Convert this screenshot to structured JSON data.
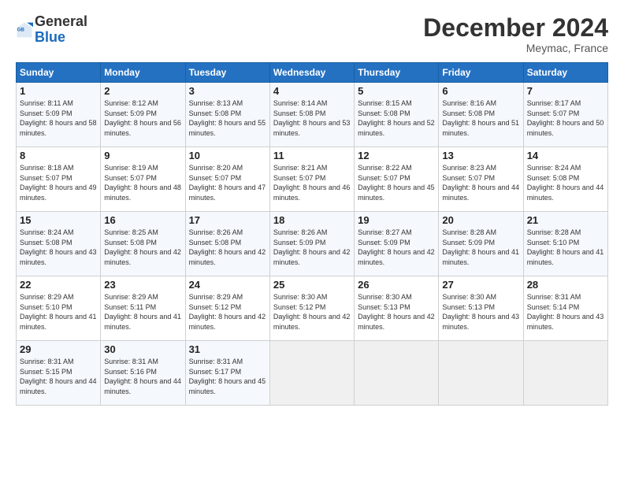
{
  "logo": {
    "general": "General",
    "blue": "Blue"
  },
  "title": "December 2024",
  "location": "Meymac, France",
  "header_days": [
    "Sunday",
    "Monday",
    "Tuesday",
    "Wednesday",
    "Thursday",
    "Friday",
    "Saturday"
  ],
  "weeks": [
    [
      {
        "day": "1",
        "sunrise": "Sunrise: 8:11 AM",
        "sunset": "Sunset: 5:09 PM",
        "daylight": "Daylight: 8 hours and 58 minutes."
      },
      {
        "day": "2",
        "sunrise": "Sunrise: 8:12 AM",
        "sunset": "Sunset: 5:09 PM",
        "daylight": "Daylight: 8 hours and 56 minutes."
      },
      {
        "day": "3",
        "sunrise": "Sunrise: 8:13 AM",
        "sunset": "Sunset: 5:08 PM",
        "daylight": "Daylight: 8 hours and 55 minutes."
      },
      {
        "day": "4",
        "sunrise": "Sunrise: 8:14 AM",
        "sunset": "Sunset: 5:08 PM",
        "daylight": "Daylight: 8 hours and 53 minutes."
      },
      {
        "day": "5",
        "sunrise": "Sunrise: 8:15 AM",
        "sunset": "Sunset: 5:08 PM",
        "daylight": "Daylight: 8 hours and 52 minutes."
      },
      {
        "day": "6",
        "sunrise": "Sunrise: 8:16 AM",
        "sunset": "Sunset: 5:08 PM",
        "daylight": "Daylight: 8 hours and 51 minutes."
      },
      {
        "day": "7",
        "sunrise": "Sunrise: 8:17 AM",
        "sunset": "Sunset: 5:07 PM",
        "daylight": "Daylight: 8 hours and 50 minutes."
      }
    ],
    [
      {
        "day": "8",
        "sunrise": "Sunrise: 8:18 AM",
        "sunset": "Sunset: 5:07 PM",
        "daylight": "Daylight: 8 hours and 49 minutes."
      },
      {
        "day": "9",
        "sunrise": "Sunrise: 8:19 AM",
        "sunset": "Sunset: 5:07 PM",
        "daylight": "Daylight: 8 hours and 48 minutes."
      },
      {
        "day": "10",
        "sunrise": "Sunrise: 8:20 AM",
        "sunset": "Sunset: 5:07 PM",
        "daylight": "Daylight: 8 hours and 47 minutes."
      },
      {
        "day": "11",
        "sunrise": "Sunrise: 8:21 AM",
        "sunset": "Sunset: 5:07 PM",
        "daylight": "Daylight: 8 hours and 46 minutes."
      },
      {
        "day": "12",
        "sunrise": "Sunrise: 8:22 AM",
        "sunset": "Sunset: 5:07 PM",
        "daylight": "Daylight: 8 hours and 45 minutes."
      },
      {
        "day": "13",
        "sunrise": "Sunrise: 8:23 AM",
        "sunset": "Sunset: 5:07 PM",
        "daylight": "Daylight: 8 hours and 44 minutes."
      },
      {
        "day": "14",
        "sunrise": "Sunrise: 8:24 AM",
        "sunset": "Sunset: 5:08 PM",
        "daylight": "Daylight: 8 hours and 44 minutes."
      }
    ],
    [
      {
        "day": "15",
        "sunrise": "Sunrise: 8:24 AM",
        "sunset": "Sunset: 5:08 PM",
        "daylight": "Daylight: 8 hours and 43 minutes."
      },
      {
        "day": "16",
        "sunrise": "Sunrise: 8:25 AM",
        "sunset": "Sunset: 5:08 PM",
        "daylight": "Daylight: 8 hours and 42 minutes."
      },
      {
        "day": "17",
        "sunrise": "Sunrise: 8:26 AM",
        "sunset": "Sunset: 5:08 PM",
        "daylight": "Daylight: 8 hours and 42 minutes."
      },
      {
        "day": "18",
        "sunrise": "Sunrise: 8:26 AM",
        "sunset": "Sunset: 5:09 PM",
        "daylight": "Daylight: 8 hours and 42 minutes."
      },
      {
        "day": "19",
        "sunrise": "Sunrise: 8:27 AM",
        "sunset": "Sunset: 5:09 PM",
        "daylight": "Daylight: 8 hours and 42 minutes."
      },
      {
        "day": "20",
        "sunrise": "Sunrise: 8:28 AM",
        "sunset": "Sunset: 5:09 PM",
        "daylight": "Daylight: 8 hours and 41 minutes."
      },
      {
        "day": "21",
        "sunrise": "Sunrise: 8:28 AM",
        "sunset": "Sunset: 5:10 PM",
        "daylight": "Daylight: 8 hours and 41 minutes."
      }
    ],
    [
      {
        "day": "22",
        "sunrise": "Sunrise: 8:29 AM",
        "sunset": "Sunset: 5:10 PM",
        "daylight": "Daylight: 8 hours and 41 minutes."
      },
      {
        "day": "23",
        "sunrise": "Sunrise: 8:29 AM",
        "sunset": "Sunset: 5:11 PM",
        "daylight": "Daylight: 8 hours and 41 minutes."
      },
      {
        "day": "24",
        "sunrise": "Sunrise: 8:29 AM",
        "sunset": "Sunset: 5:12 PM",
        "daylight": "Daylight: 8 hours and 42 minutes."
      },
      {
        "day": "25",
        "sunrise": "Sunrise: 8:30 AM",
        "sunset": "Sunset: 5:12 PM",
        "daylight": "Daylight: 8 hours and 42 minutes."
      },
      {
        "day": "26",
        "sunrise": "Sunrise: 8:30 AM",
        "sunset": "Sunset: 5:13 PM",
        "daylight": "Daylight: 8 hours and 42 minutes."
      },
      {
        "day": "27",
        "sunrise": "Sunrise: 8:30 AM",
        "sunset": "Sunset: 5:13 PM",
        "daylight": "Daylight: 8 hours and 43 minutes."
      },
      {
        "day": "28",
        "sunrise": "Sunrise: 8:31 AM",
        "sunset": "Sunset: 5:14 PM",
        "daylight": "Daylight: 8 hours and 43 minutes."
      }
    ],
    [
      {
        "day": "29",
        "sunrise": "Sunrise: 8:31 AM",
        "sunset": "Sunset: 5:15 PM",
        "daylight": "Daylight: 8 hours and 44 minutes."
      },
      {
        "day": "30",
        "sunrise": "Sunrise: 8:31 AM",
        "sunset": "Sunset: 5:16 PM",
        "daylight": "Daylight: 8 hours and 44 minutes."
      },
      {
        "day": "31",
        "sunrise": "Sunrise: 8:31 AM",
        "sunset": "Sunset: 5:17 PM",
        "daylight": "Daylight: 8 hours and 45 minutes."
      },
      null,
      null,
      null,
      null
    ]
  ]
}
